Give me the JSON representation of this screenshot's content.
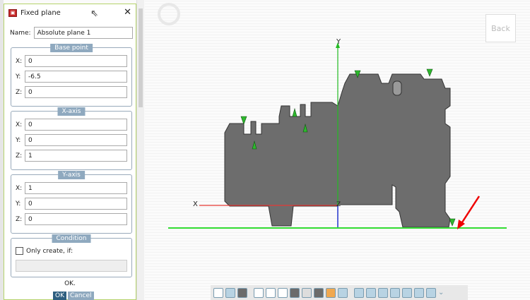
{
  "dialog": {
    "title": "Fixed plane",
    "name_label": "Name:",
    "name_value": "Absolute plane 1",
    "base_point": {
      "legend": "Base point",
      "x": "0",
      "y": "-6.5",
      "z": "0"
    },
    "x_axis": {
      "legend": "X-axis",
      "x": "0",
      "y": "0",
      "z": "1"
    },
    "y_axis": {
      "legend": "Y-axis",
      "x": "1",
      "y": "0",
      "z": "0"
    },
    "condition": {
      "legend": "Condition",
      "checkbox_label": "Only create, if:",
      "value": ""
    },
    "status": "OK.",
    "ok": "OK",
    "cancel": "Cancel"
  },
  "labels": {
    "x": "X:",
    "y": "Y:",
    "z": "Z:"
  },
  "viewport": {
    "back": "Back",
    "axis_x": "X",
    "axis_y": "Y",
    "axis_z": "Z"
  }
}
